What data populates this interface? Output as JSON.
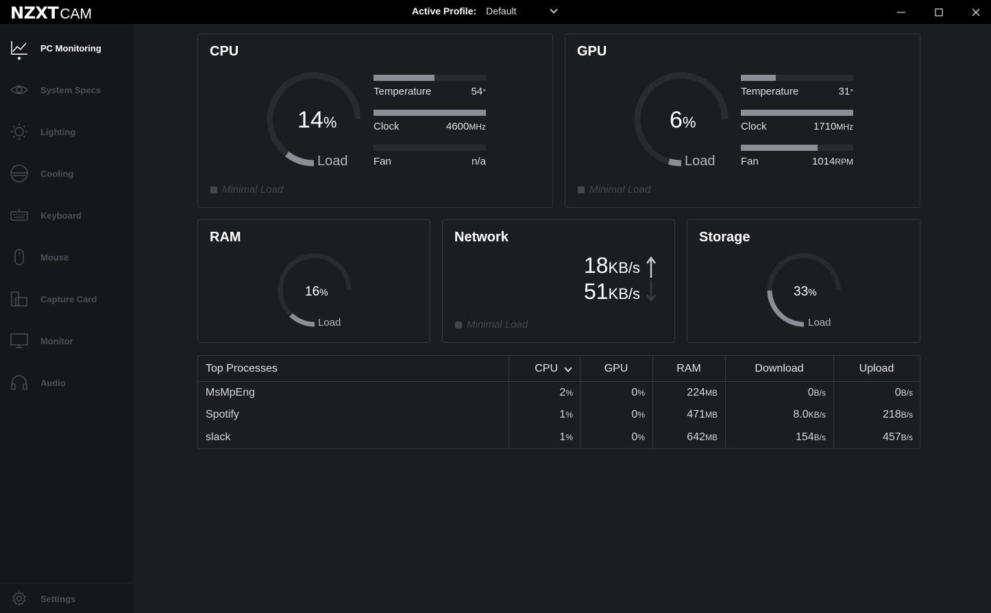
{
  "app": {
    "logo_main": "NZXT",
    "logo_sub": "CAM"
  },
  "header": {
    "profile_label": "Active Profile:",
    "profile_value": "Default"
  },
  "sidebar": {
    "items": [
      {
        "label": "PC Monitoring",
        "icon": "line-chart-icon",
        "active": true
      },
      {
        "label": "System Specs",
        "icon": "eye-icon"
      },
      {
        "label": "Lighting",
        "icon": "sun-icon"
      },
      {
        "label": "Cooling",
        "icon": "cooler-icon"
      },
      {
        "label": "Keyboard",
        "icon": "keyboard-icon"
      },
      {
        "label": "Mouse",
        "icon": "mouse-icon"
      },
      {
        "label": "Capture Card",
        "icon": "capture-card-icon"
      },
      {
        "label": "Monitor",
        "icon": "monitor-icon"
      },
      {
        "label": "Audio",
        "icon": "headset-icon"
      }
    ],
    "settings_label": "Settings"
  },
  "cpu": {
    "title": "CPU",
    "load_value": "14",
    "load_unit": "%",
    "load_label": "Load",
    "load_fraction": 0.14,
    "temp_label": "Temperature",
    "temp_value": "54",
    "temp_unit": "°",
    "temp_fraction": 0.54,
    "clock_label": "Clock",
    "clock_value": "4600",
    "clock_unit": "MHz",
    "clock_fraction": 1.0,
    "fan_label": "Fan",
    "fan_value": "n/a",
    "fan_fraction": 0.0,
    "status": "Minimal Load"
  },
  "gpu": {
    "title": "GPU",
    "load_value": "6",
    "load_unit": "%",
    "load_label": "Load",
    "load_fraction": 0.06,
    "temp_label": "Temperature",
    "temp_value": "31",
    "temp_unit": "°",
    "temp_fraction": 0.31,
    "clock_label": "Clock",
    "clock_value": "1710",
    "clock_unit": "MHz",
    "clock_fraction": 1.0,
    "fan_label": "Fan",
    "fan_value": "1014",
    "fan_unit": "RPM",
    "fan_fraction": 0.68,
    "status": "Minimal Load"
  },
  "ram": {
    "title": "RAM",
    "load_value": "16",
    "load_unit": "%",
    "load_label": "Load",
    "load_fraction": 0.16
  },
  "network": {
    "title": "Network",
    "upload_value": "18",
    "upload_unit": "KB/s",
    "download_value": "51",
    "download_unit": "KB/s",
    "status": "Minimal Load"
  },
  "storage": {
    "title": "Storage",
    "load_value": "33",
    "load_unit": "%",
    "load_label": "Load",
    "load_fraction": 0.33
  },
  "processes": {
    "headers": {
      "name": "Top Processes",
      "cpu": "CPU",
      "gpu": "GPU",
      "ram": "RAM",
      "download": "Download",
      "upload": "Upload"
    },
    "rows": [
      {
        "name": "MsMpEng",
        "cpu": "2",
        "cpu_u": "%",
        "gpu": "0",
        "gpu_u": "%",
        "ram": "224",
        "ram_u": "MB",
        "dl": "0",
        "dl_u": "B/s",
        "ul": "0",
        "ul_u": "B/s"
      },
      {
        "name": "Spotify",
        "cpu": "1",
        "cpu_u": "%",
        "gpu": "0",
        "gpu_u": "%",
        "ram": "471",
        "ram_u": "MB",
        "dl": "8.0",
        "dl_u": "KB/s",
        "ul": "218",
        "ul_u": "B/s"
      },
      {
        "name": "slack",
        "cpu": "1",
        "cpu_u": "%",
        "gpu": "0",
        "gpu_u": "%",
        "ram": "642",
        "ram_u": "MB",
        "dl": "154",
        "dl_u": "B/s",
        "ul": "457",
        "ul_u": "B/s"
      }
    ]
  },
  "colors": {
    "accent_gauge": "#8d8e95",
    "track": "#2a2b2f",
    "background": "#1c1d20",
    "sidebar": "#161719"
  }
}
